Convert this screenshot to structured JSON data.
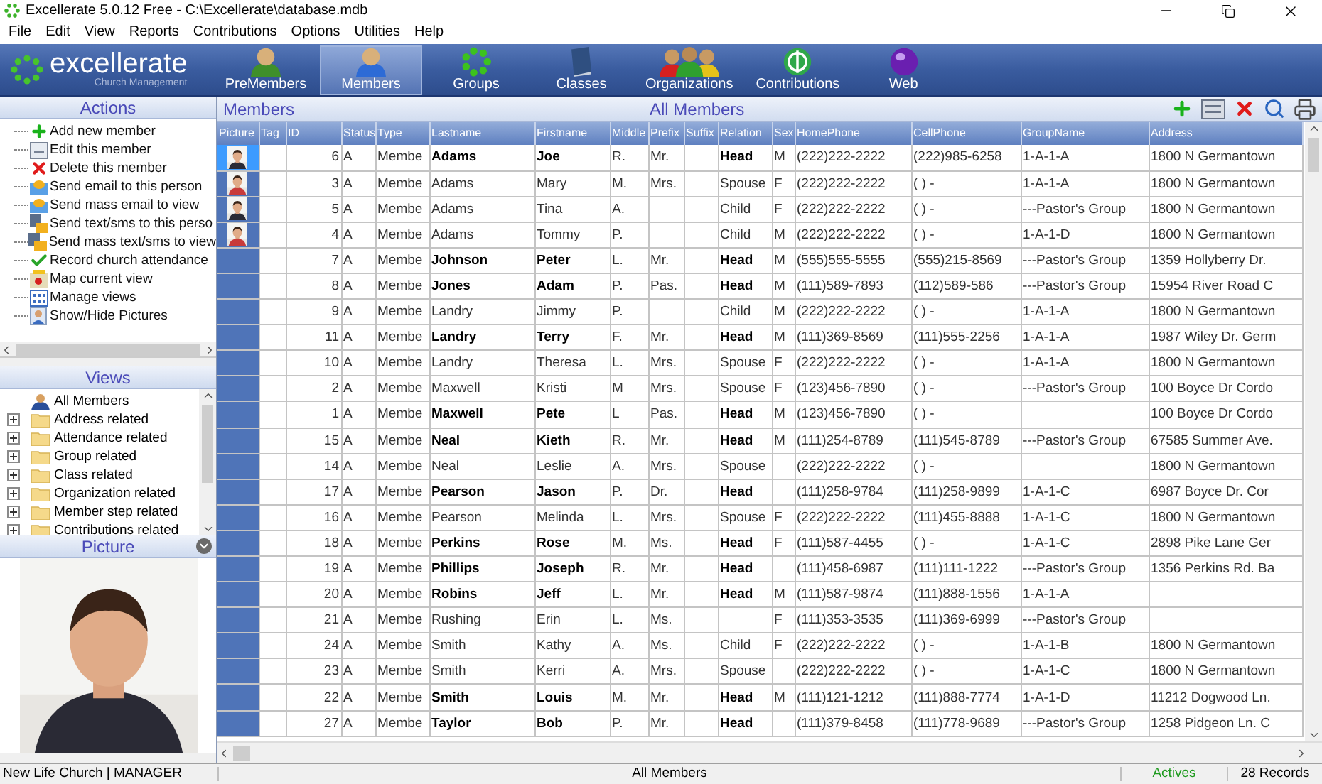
{
  "window": {
    "title": "Excellerate 5.0.12 Free - C:\\Excellerate\\database.mdb"
  },
  "menu": [
    "File",
    "Edit",
    "View",
    "Reports",
    "Contributions",
    "Options",
    "Utilities",
    "Help"
  ],
  "logo": {
    "name": "excellerate",
    "tagline": "Church Management"
  },
  "nav": [
    {
      "label": "PreMembers",
      "kind": "premember",
      "selected": false
    },
    {
      "label": "Members",
      "kind": "member",
      "selected": true
    },
    {
      "label": "Groups",
      "kind": "groups",
      "selected": false
    },
    {
      "label": "Classes",
      "kind": "book",
      "selected": false
    },
    {
      "label": "Organizations",
      "kind": "people",
      "selected": false
    },
    {
      "label": "Contributions",
      "kind": "coin",
      "selected": false
    },
    {
      "label": "Web",
      "kind": "globe",
      "selected": false
    }
  ],
  "actions": {
    "title": "Actions",
    "items": [
      {
        "label": "Add new member",
        "kind": "add"
      },
      {
        "label": "Edit this member",
        "kind": "form"
      },
      {
        "label": "Delete this member",
        "kind": "delete"
      },
      {
        "label": "Send email to this person",
        "kind": "mail"
      },
      {
        "label": "Send mass email to view",
        "kind": "mail"
      },
      {
        "label": "Send text/sms to this perso",
        "kind": "sms"
      },
      {
        "label": "Send mass text/sms to view",
        "kind": "sms"
      },
      {
        "label": "Record church attendance",
        "kind": "check"
      },
      {
        "label": "Map current view",
        "kind": "map"
      },
      {
        "label": "Manage views",
        "kind": "grid"
      },
      {
        "label": "Show/Hide Pictures"
      }
    ]
  },
  "views": {
    "title": "Views",
    "items": [
      {
        "label": "All Members",
        "kind": "all"
      },
      {
        "label": "Address related",
        "kind": "folder",
        "expanded": false
      },
      {
        "label": "Attendance related",
        "kind": "folder",
        "expanded": false
      },
      {
        "label": "Group related",
        "kind": "folder",
        "expanded": false
      },
      {
        "label": "Class related",
        "kind": "folder",
        "expanded": false
      },
      {
        "label": "Organization related",
        "kind": "folder",
        "expanded": false
      },
      {
        "label": "Member step related",
        "kind": "folder",
        "expanded": false
      },
      {
        "label": "Contributions related",
        "kind": "folder",
        "expanded": false
      }
    ]
  },
  "picture_panel": {
    "title": "Picture"
  },
  "members": {
    "title": "Members",
    "view": "All Members"
  },
  "table": {
    "columns": [
      "Picture",
      "Tag",
      "ID",
      "Status",
      "Type",
      "Lastname",
      "Firstname",
      "Middle",
      "Prefix",
      "Suffix",
      "Relation",
      "Sex",
      "HomePhone",
      "CellPhone",
      "GroupName",
      "Address"
    ],
    "rows": [
      {
        "photo": true,
        "selected": true,
        "head": true,
        "id": "6",
        "status": "A",
        "type": "Membe",
        "lastname": "Adams",
        "firstname": "Joe",
        "middle": "R.",
        "prefix": "Mr.",
        "relation": "Head",
        "sex": "M",
        "home": "(222)222-2222",
        "cell": "(222)985-6258",
        "group": "1-A-1-A",
        "address": "1800 N Germantown"
      },
      {
        "photo": true,
        "selected": false,
        "head": false,
        "id": "3",
        "status": "A",
        "type": "Membe",
        "lastname": "Adams",
        "firstname": "Mary",
        "middle": "M.",
        "prefix": "Mrs.",
        "relation": "Spouse",
        "sex": "F",
        "home": "(222)222-2222",
        "cell": "(  )  -",
        "group": "1-A-1-A",
        "address": "1800 N Germantown"
      },
      {
        "photo": true,
        "selected": false,
        "head": false,
        "id": "5",
        "status": "A",
        "type": "Membe",
        "lastname": "Adams",
        "firstname": "Tina",
        "middle": "A.",
        "relation": "Child",
        "sex": "F",
        "home": "(222)222-2222",
        "cell": "(  )  -",
        "group": "---Pastor's Group",
        "address": "1800 N Germantown"
      },
      {
        "photo": true,
        "selected": false,
        "head": false,
        "id": "4",
        "status": "A",
        "type": "Membe",
        "lastname": "Adams",
        "firstname": "Tommy",
        "middle": "P.",
        "relation": "Child",
        "sex": "M",
        "home": "(222)222-2222",
        "cell": "(  )  -",
        "group": "1-A-1-D",
        "address": "1800 N Germantown"
      },
      {
        "photo": false,
        "selected": false,
        "head": true,
        "id": "7",
        "status": "A",
        "type": "Membe",
        "lastname": "Johnson",
        "firstname": "Peter",
        "middle": "L.",
        "prefix": "Mr.",
        "relation": "Head",
        "sex": "M",
        "home": "(555)555-5555",
        "cell": "(555)215-8569",
        "group": "---Pastor's Group",
        "address": "1359 Hollyberry Dr."
      },
      {
        "photo": false,
        "selected": false,
        "head": true,
        "id": "8",
        "status": "A",
        "type": "Membe",
        "lastname": "Jones",
        "firstname": "Adam",
        "middle": "P.",
        "prefix": "Pas.",
        "relation": "Head",
        "sex": "M",
        "home": "(111)589-7893",
        "cell": "(112)589-586",
        "group": "---Pastor's Group",
        "address": "15954 River Road C"
      },
      {
        "photo": false,
        "selected": false,
        "head": false,
        "id": "9",
        "status": "A",
        "type": "Membe",
        "lastname": "Landry",
        "firstname": "Jimmy",
        "middle": "P.",
        "relation": "Child",
        "sex": "M",
        "home": "(222)222-2222",
        "cell": "(  )  -",
        "group": "1-A-1-A",
        "address": "1800 N Germantown"
      },
      {
        "photo": false,
        "selected": false,
        "head": true,
        "id": "11",
        "status": "A",
        "type": "Membe",
        "lastname": "Landry",
        "firstname": "Terry",
        "middle": "F.",
        "prefix": "Mr.",
        "relation": "Head",
        "sex": "M",
        "home": "(111)369-8569",
        "cell": "(111)555-2256",
        "group": "1-A-1-A",
        "address": "1987 Wiley Dr. Germ"
      },
      {
        "photo": false,
        "selected": false,
        "head": false,
        "id": "10",
        "status": "A",
        "type": "Membe",
        "lastname": "Landry",
        "firstname": "Theresa",
        "middle": "L.",
        "prefix": "Mrs.",
        "relation": "Spouse",
        "sex": "F",
        "home": "(222)222-2222",
        "cell": "(  )  -",
        "group": "1-A-1-A",
        "address": "1800 N Germantown"
      },
      {
        "photo": false,
        "selected": false,
        "head": false,
        "id": "2",
        "status": "A",
        "type": "Membe",
        "lastname": "Maxwell",
        "firstname": "Kristi",
        "middle": "M",
        "prefix": "Mrs.",
        "relation": "Spouse",
        "sex": "F",
        "home": "(123)456-7890",
        "cell": "(  )  -",
        "group": "---Pastor's Group",
        "address": "100 Boyce Dr Cordo"
      },
      {
        "photo": false,
        "selected": false,
        "head": true,
        "id": "1",
        "status": "A",
        "type": "Membe",
        "lastname": "Maxwell",
        "firstname": "Pete",
        "middle": "L",
        "prefix": "Pas.",
        "relation": "Head",
        "sex": "M",
        "home": "(123)456-7890",
        "cell": "(  )  -",
        "address": "100 Boyce Dr Cordo"
      },
      {
        "photo": false,
        "selected": false,
        "head": true,
        "id": "15",
        "status": "A",
        "type": "Membe",
        "lastname": "Neal",
        "firstname": "Kieth",
        "middle": "R.",
        "prefix": "Mr.",
        "relation": "Head",
        "sex": "M",
        "home": "(111)254-8789",
        "cell": "(111)545-8789",
        "group": "---Pastor's Group",
        "address": "67585 Summer Ave."
      },
      {
        "photo": false,
        "selected": false,
        "head": false,
        "id": "14",
        "status": "A",
        "type": "Membe",
        "lastname": "Neal",
        "firstname": "Leslie",
        "middle": "A.",
        "prefix": "Mrs.",
        "relation": "Spouse",
        "home": "(222)222-2222",
        "cell": "(  )  -",
        "address": "1800 N Germantown"
      },
      {
        "photo": false,
        "selected": false,
        "head": true,
        "id": "17",
        "status": "A",
        "type": "Membe",
        "lastname": "Pearson",
        "firstname": "Jason",
        "middle": "P.",
        "prefix": "Dr.",
        "relation": "Head",
        "home": "(111)258-9784",
        "cell": "(111)258-9899",
        "group": "1-A-1-C",
        "address": "6987 Boyce Dr. Cor"
      },
      {
        "photo": false,
        "selected": false,
        "head": false,
        "id": "16",
        "status": "A",
        "type": "Membe",
        "lastname": "Pearson",
        "firstname": "Melinda",
        "middle": "L.",
        "prefix": "Mrs.",
        "relation": "Spouse",
        "sex": "F",
        "home": "(222)222-2222",
        "cell": "(111)455-8888",
        "group": "1-A-1-C",
        "address": "1800 N Germantown"
      },
      {
        "photo": false,
        "selected": false,
        "head": true,
        "id": "18",
        "status": "A",
        "type": "Membe",
        "lastname": "Perkins",
        "firstname": "Rose",
        "middle": "M.",
        "prefix": "Ms.",
        "relation": "Head",
        "sex": "F",
        "home": "(111)587-4455",
        "cell": "(  )  -",
        "group": "1-A-1-C",
        "address": "2898 Pike Lane Ger"
      },
      {
        "photo": false,
        "selected": false,
        "head": true,
        "id": "19",
        "status": "A",
        "type": "Membe",
        "lastname": "Phillips",
        "firstname": "Joseph",
        "middle": "R.",
        "prefix": "Mr.",
        "relation": "Head",
        "home": "(111)458-6987",
        "cell": "(111)111-1222",
        "group": "---Pastor's Group",
        "address": "1356 Perkins Rd. Ba"
      },
      {
        "photo": false,
        "selected": false,
        "head": true,
        "id": "20",
        "status": "A",
        "type": "Membe",
        "lastname": "Robins",
        "firstname": "Jeff",
        "middle": "L.",
        "prefix": "Mr.",
        "relation": "Head",
        "sex": "M",
        "home": "(111)587-9874",
        "cell": "(111)888-1556",
        "group": "1-A-1-A"
      },
      {
        "photo": false,
        "selected": false,
        "head": false,
        "id": "21",
        "status": "A",
        "type": "Membe",
        "lastname": "Rushing",
        "firstname": "Erin",
        "middle": "L.",
        "prefix": "Ms.",
        "sex": "F",
        "home": "(111)353-3535",
        "cell": "(111)369-6999",
        "group": "---Pastor's Group"
      },
      {
        "photo": false,
        "selected": false,
        "head": false,
        "id": "24",
        "status": "A",
        "type": "Membe",
        "lastname": "Smith",
        "firstname": "Kathy",
        "middle": "A.",
        "prefix": "Ms.",
        "relation": "Child",
        "sex": "F",
        "home": "(222)222-2222",
        "cell": "(  )  -",
        "group": "1-A-1-B",
        "address": "1800 N Germantown"
      },
      {
        "photo": false,
        "selected": false,
        "head": false,
        "id": "23",
        "status": "A",
        "type": "Membe",
        "lastname": "Smith",
        "firstname": "Kerri",
        "middle": "A.",
        "prefix": "Mrs.",
        "relation": "Spouse",
        "home": "(222)222-2222",
        "cell": "(  )  -",
        "group": "1-A-1-C",
        "address": "1800 N Germantown"
      },
      {
        "photo": false,
        "selected": false,
        "head": true,
        "id": "22",
        "status": "A",
        "type": "Membe",
        "lastname": "Smith",
        "firstname": "Louis",
        "middle": "M.",
        "prefix": "Mr.",
        "relation": "Head",
        "sex": "M",
        "home": "(111)121-1212",
        "cell": "(111)888-7774",
        "group": "1-A-1-D",
        "address": "11212 Dogwood Ln."
      },
      {
        "photo": false,
        "selected": false,
        "head": true,
        "id": "27",
        "status": "A",
        "type": "Membe",
        "lastname": "Taylor",
        "firstname": "Bob",
        "middle": "P.",
        "prefix": "Mr.",
        "relation": "Head",
        "home": "(111)379-8458",
        "cell": "(111)778-9689",
        "group": "---Pastor's Group",
        "address": "1258 Pidgeon Ln. C"
      }
    ]
  },
  "status_bar": {
    "user": "New Life Church | MANAGER",
    "view": "All Members",
    "filter": "Actives",
    "records": "28 Records"
  }
}
